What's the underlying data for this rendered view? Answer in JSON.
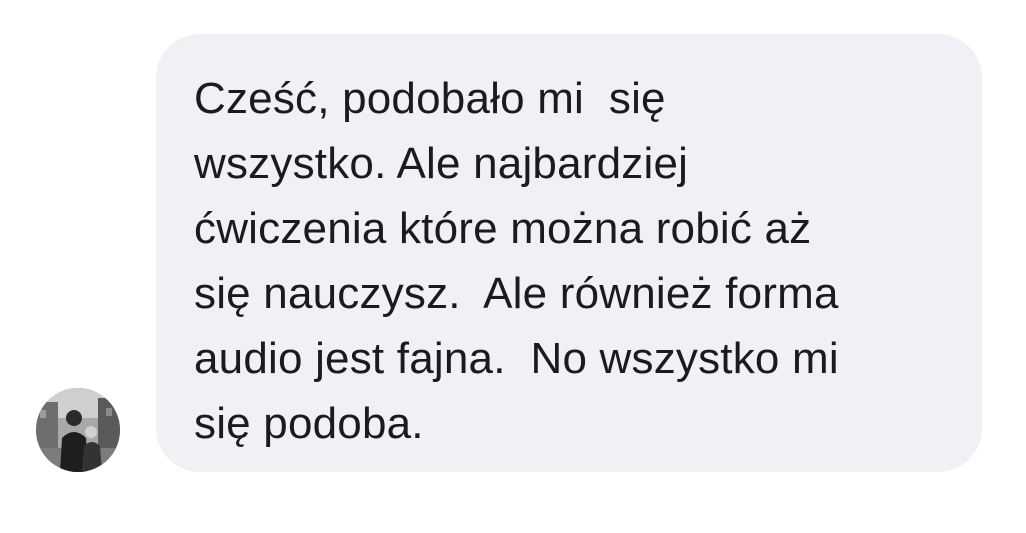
{
  "conversation": {
    "sender": {
      "avatar_icon": "profile-photo-avatar"
    },
    "message": {
      "lines": [
        "Cześć, podobało mi  się",
        "wszystko. Ale najbardziej",
        "ćwiczenia które można robić aż",
        "się nauczysz.  Ale również forma",
        "audio jest fajna.  No wszystko mi",
        "się podoba."
      ],
      "bubble_color": "#f0f0f5",
      "text_color": "#1b1b1f"
    }
  }
}
